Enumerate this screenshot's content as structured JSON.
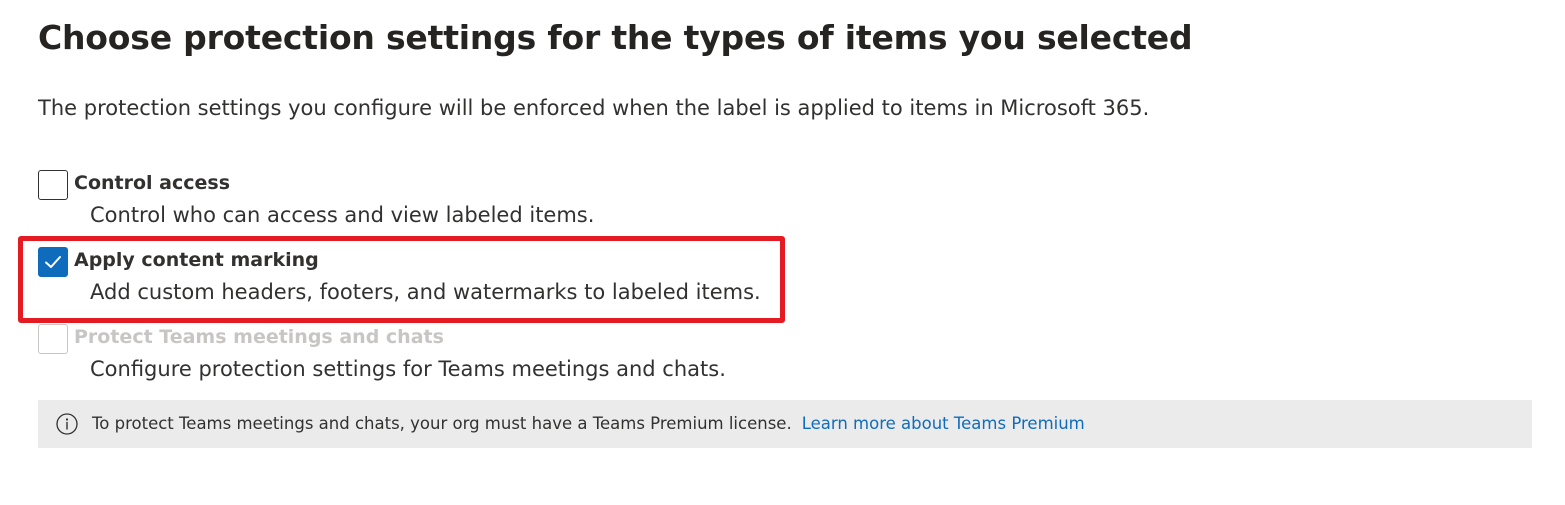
{
  "page": {
    "title": "Choose protection settings for the types of items you selected",
    "description": "The protection settings you configure will be enforced when the label is applied to items in Microsoft 365."
  },
  "options": [
    {
      "label": "Control access",
      "description": "Control who can access and view labeled items.",
      "checked": false,
      "disabled": false
    },
    {
      "label": "Apply content marking",
      "description": "Add custom headers, footers, and watermarks to labeled items.",
      "checked": true,
      "disabled": false,
      "highlighted": true
    },
    {
      "label": "Protect Teams meetings and chats",
      "description": "Configure protection settings for Teams meetings and chats.",
      "checked": false,
      "disabled": true
    }
  ],
  "info_bar": {
    "icon": "info-icon",
    "message": "To protect Teams meetings and chats, your org must have a Teams Premium license.",
    "link_text": "Learn more about Teams Premium"
  },
  "colors": {
    "accent": "#0f6cbd",
    "highlight": "#e51b24",
    "disabled": "#c8c6c4",
    "info_background": "#ebebeb"
  }
}
